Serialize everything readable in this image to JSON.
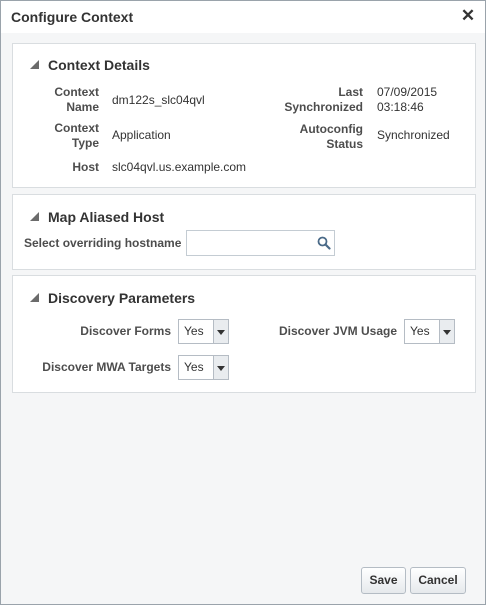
{
  "dialog": {
    "title": "Configure Context",
    "close_symbol": "✕"
  },
  "context_details": {
    "heading": "Context Details",
    "context_name_label": "Context\nName",
    "context_name": "dm122s_slc04qvl",
    "context_type_label": "Context\nType",
    "context_type": "Application",
    "host_label": "Host",
    "host": "slc04qvl.us.example.com",
    "last_synchronized_label": "Last\nSynchronized",
    "last_synchronized": "07/09/2015\n03:18:46",
    "autoconfig_status_label": "Autoconfig\nStatus",
    "autoconfig_status": "Synchronized"
  },
  "map_aliased_host": {
    "heading": "Map Aliased Host",
    "hostname_label": "Select overriding hostname",
    "hostname_value": "",
    "search_icon": "search-icon"
  },
  "discovery_parameters": {
    "heading": "Discovery Parameters",
    "discover_forms_label": "Discover Forms",
    "discover_forms_value": "Yes",
    "discover_jvm_label": "Discover JVM Usage",
    "discover_jvm_value": "Yes",
    "discover_mwa_label": "Discover MWA Targets",
    "discover_mwa_value": "Yes"
  },
  "footer": {
    "save_label": "Save",
    "cancel_label": "Cancel"
  }
}
